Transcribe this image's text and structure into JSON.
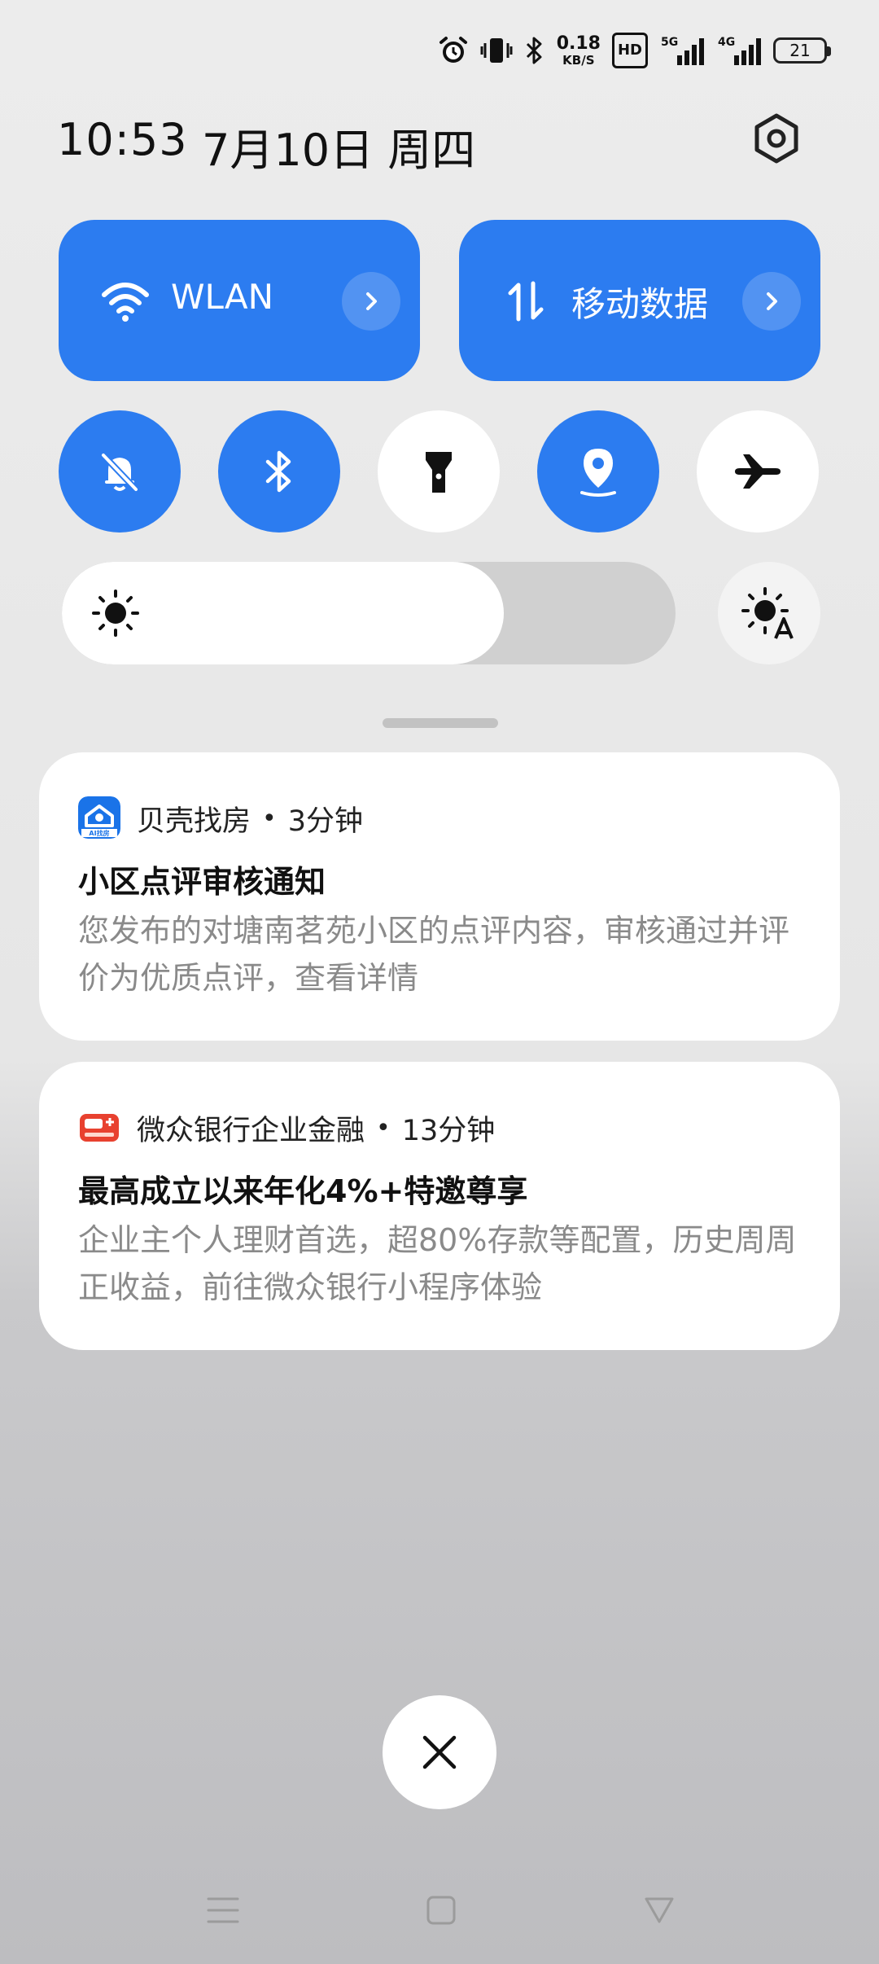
{
  "status_bar": {
    "net_speed_value": "0.18",
    "net_speed_unit": "KB/S",
    "hd_badge": "HD",
    "signal1_label": "5G",
    "signal2_label": "4G",
    "battery_level": "21",
    "icons": [
      "alarm-icon",
      "vibrate-icon",
      "bluetooth-icon",
      "signal-5g-icon",
      "signal-4g-icon",
      "battery-icon"
    ]
  },
  "header": {
    "time": "10:53",
    "date": "7月10日 周四",
    "settings_icon": "gear-icon"
  },
  "quick_tiles": {
    "wlan": {
      "label": "WLAN",
      "state": "on",
      "icon": "wifi-icon"
    },
    "mobile_data": {
      "label": "移动数据",
      "state": "on",
      "icon": "data-arrows-icon"
    }
  },
  "toggles": [
    {
      "name": "mute",
      "icon": "bell-off-icon",
      "state": "on"
    },
    {
      "name": "bluetooth",
      "icon": "bluetooth-icon",
      "state": "on"
    },
    {
      "name": "flashlight",
      "icon": "flashlight-icon",
      "state": "off"
    },
    {
      "name": "location",
      "icon": "location-pin-icon",
      "state": "on"
    },
    {
      "name": "airplane",
      "icon": "airplane-icon",
      "state": "off"
    }
  ],
  "brightness": {
    "level": 0.72,
    "auto_icon": "auto-brightness-icon"
  },
  "notifications": [
    {
      "app": "贝壳找房",
      "time": "3分钟",
      "title": "小区点评审核通知",
      "body": "您发布的对塘南茗苑小区的点评内容，审核通过并评价为优质点评，查看详情",
      "icon_caption": "AI找房"
    },
    {
      "app": "微众银行企业金融",
      "time": "13分钟",
      "title": "最高成立以来年化4%+特邀尊享",
      "body": "企业主个人理财首选，超80%存款等配置，历史周周正收益，前往微众银行小程序体验"
    }
  ],
  "colors": {
    "accent": "#2c7cf0",
    "tile_off": "#ffffff",
    "body_text": "#8a8a8a"
  }
}
